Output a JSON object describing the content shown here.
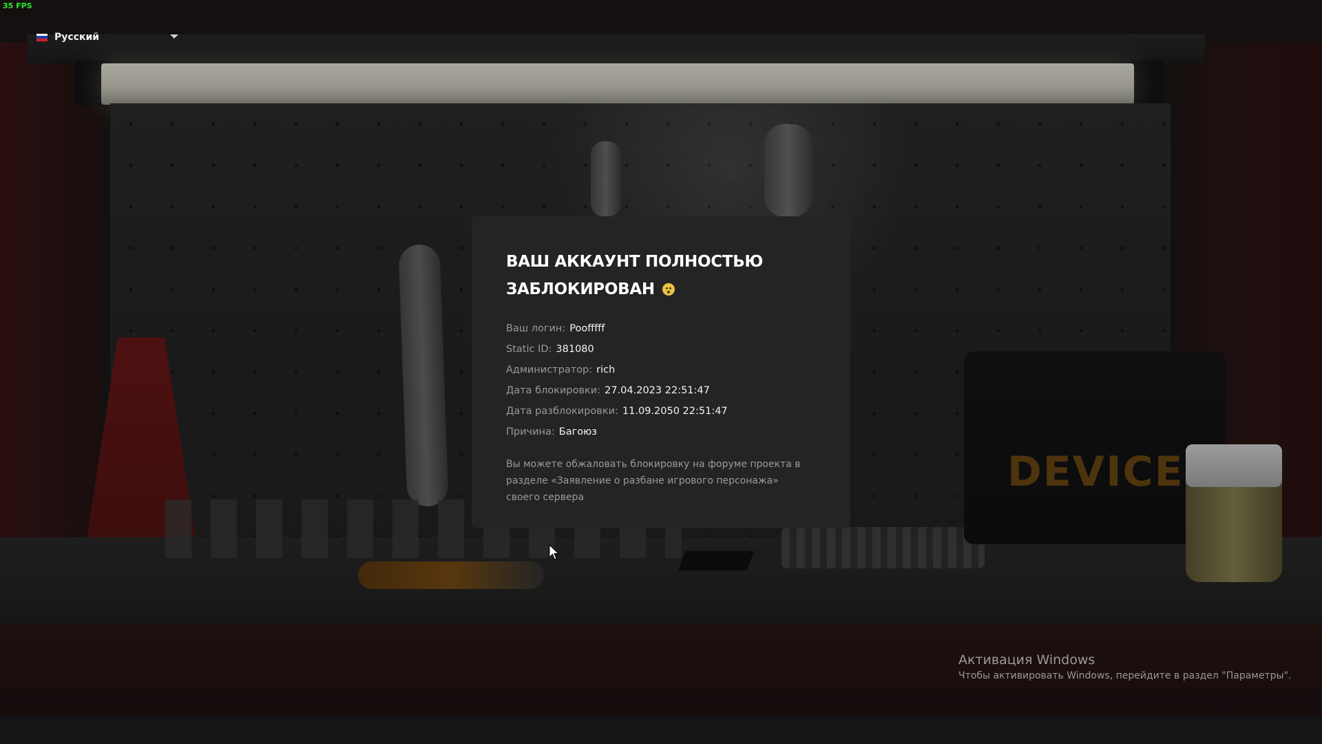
{
  "hud": {
    "fps": "35 FPS",
    "language": {
      "label": "Русский",
      "flag_colors": [
        "#ffffff",
        "#1c3faa",
        "#d21f26"
      ]
    }
  },
  "modal": {
    "title_line1": "ВАШ АККАУНТ ПОЛНОСТЬЮ",
    "title_line2": "ЗАБЛОКИРОВАН",
    "title_emoji": "sad-face-emoji",
    "fields": [
      {
        "key": "Ваш логин:",
        "value": "Poofffff"
      },
      {
        "key": "Static ID:",
        "value": "381080"
      },
      {
        "key": "Администратор:",
        "value": "rich"
      },
      {
        "key": "Дата блокировки:",
        "value": "27.04.2023 22:51:47"
      },
      {
        "key": "Дата разблокировки:",
        "value": "11.09.2050 22:51:47"
      },
      {
        "key": "Причина:",
        "value": "Багоюз"
      }
    ],
    "appeal_text": "Вы можете обжаловать блокировку на форуме проекта в разделе «Заявление о разбане игрового персонажа» своего сервера"
  },
  "background": {
    "case_logo": "DEVICE"
  },
  "watermark": {
    "title": "Активация Windows",
    "subtitle": "Чтобы активировать Windows, перейдите в раздел \"Параметры\"."
  },
  "colors": {
    "modal_bg": "#242424",
    "fps_text": "#2be82b",
    "label_text": "#9a9a9a",
    "value_text": "#f4f4f4"
  }
}
